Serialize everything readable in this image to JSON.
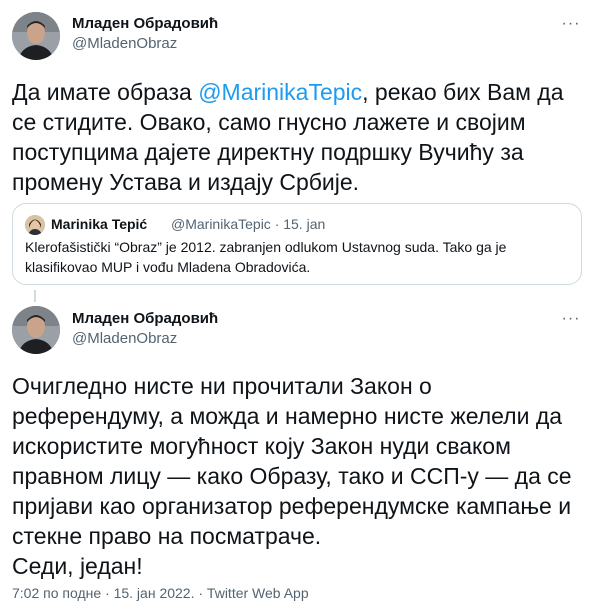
{
  "tweet1": {
    "author_name": "Младен Обрадовић",
    "author_handle": "@MladenObraz",
    "text_before": "Да имате образа ",
    "mention": "@MarinikaTepic",
    "text_after": ", рекао бих Вам да се стидите. Овако, само гнусно лажете и својим поступцима дајете директну подршку Вучићу за промену Устава и издају Србије.",
    "more_icon": "more-horizontal-icon",
    "quote": {
      "author_name": "Marinika Tepić",
      "meta": "@MarinikaTepic · 15. jan",
      "text": "Klerofašistički “Obraz” je 2012. zabranjen odlukom Ustavnog suda. Tako ga je klasifikovao MUP i vođu Mladena Obradovića."
    }
  },
  "tweet2": {
    "author_name": "Младен Обрадовић",
    "author_handle": "@MladenObraz",
    "text": "Очигледно нисте ни прочитали Закон о референдуму, а можда и намерно нисте желели да искористите могућност коју Закон нуди сваком правном лицу — како Образу, тако и ССП-у — да се пријави као организатор референдумске кампање и стекне право на посматраче.",
    "text_line2": "Седи, један!",
    "more_icon": "more-horizontal-icon"
  },
  "footer": {
    "timestamp": "7:02 по подне · 15. јан 2022. · Twitter Web App"
  },
  "colors": {
    "link": "#1d9bf0",
    "secondary": "#536471",
    "border": "#cfd9de"
  }
}
